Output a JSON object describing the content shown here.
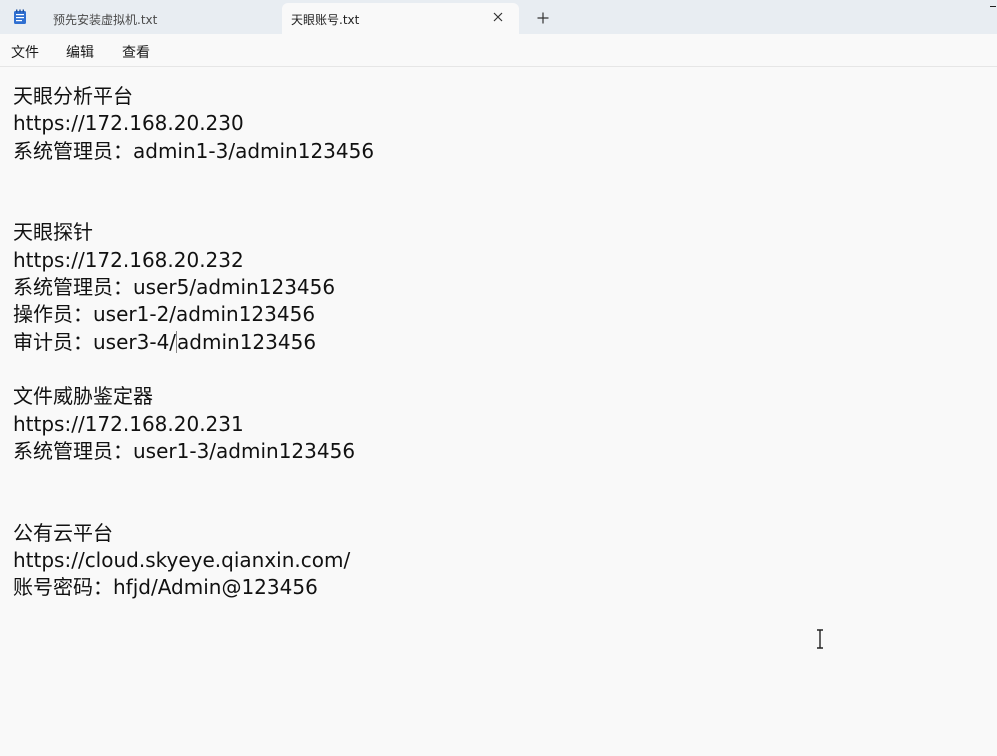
{
  "tabs": [
    {
      "label": "预先安装虚拟机.txt",
      "active": false
    },
    {
      "label": "天眼账号.txt",
      "active": true
    }
  ],
  "menu": {
    "file": "文件",
    "edit": "编辑",
    "view": "查看"
  },
  "document": {
    "lines": [
      "天眼分析平台",
      "https://172.168.20.230",
      "系统管理员：admin1-3/admin123456",
      "",
      "",
      "天眼探针",
      "https://172.168.20.232",
      "系统管理员：user5/admin123456",
      "操作员：user1-2/admin123456",
      "审计员：user3-4/",
      "",
      "文件威胁鉴定器",
      "https://172.168.20.231",
      "系统管理员：user1-3/admin123456",
      "",
      "",
      "公有云平台",
      "https://cloud.skyeye.qianxin.com/",
      "账号密码：hfjd/Admin@123456"
    ],
    "caret_line_tail": "admin123456"
  },
  "icons": {
    "app": "notepad-icon",
    "close": "close-icon",
    "new_tab": "plus-icon",
    "cursor": "text-cursor-icon"
  },
  "colors": {
    "tabbar_bg": "#e8edf2",
    "editor_bg": "#f9f9f9",
    "app_icon_blue": "#2f6fd1"
  }
}
